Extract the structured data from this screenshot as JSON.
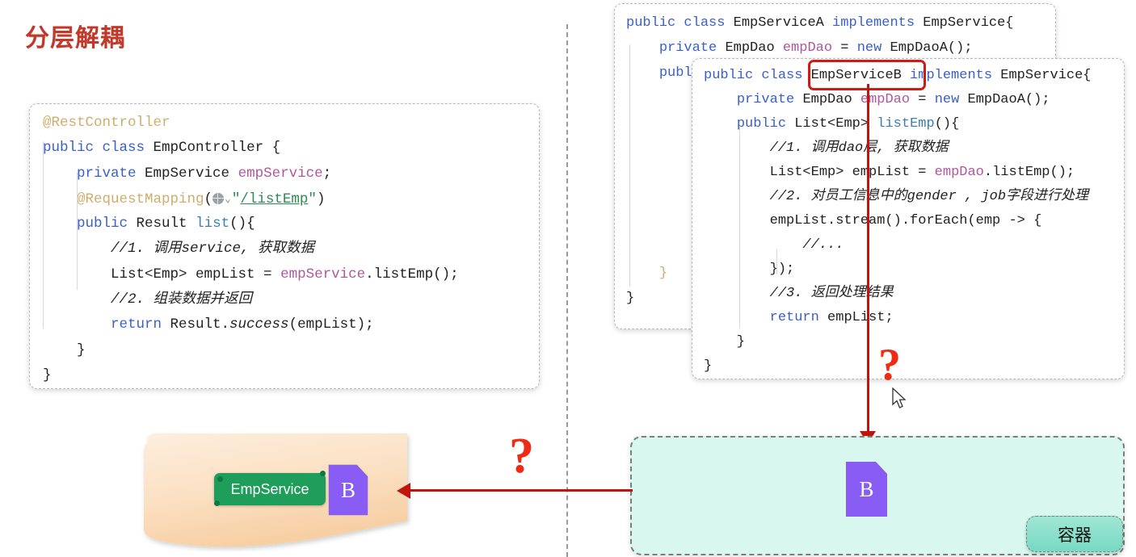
{
  "title": "分层解耦",
  "theme": {
    "title_color": "#c0392b",
    "accent_red": "#c0150f",
    "question_red": "#ef2b16",
    "bean_purple": "#8a5cf6",
    "tag_green": "#1e9e5a",
    "container_teal": "#d8f7ef",
    "badge_teal": "#77d9c2",
    "blob_orange": "#fbe0c3"
  },
  "left_code": {
    "name": "EmpController",
    "lines": [
      "@RestController",
      "public class EmpController {",
      "    private EmpService empService;",
      "    @RequestMapping(\"/listEmp\")",
      "    public Result list(){",
      "        //1. 调用service, 获取数据",
      "        List<Emp> empList = empService.listEmp();",
      "        //2. 组装数据并返回",
      "        return Result.success(empList);",
      "    }",
      "}"
    ],
    "mapping_path": "/listEmp",
    "icon": "globe-icon"
  },
  "service_a_code": {
    "name": "EmpServiceA",
    "lines": [
      "public class EmpServiceA implements EmpService{",
      "    private EmpDao empDao = new EmpDaoA();",
      "    public",
      "",
      "",
      "",
      "",
      "",
      "",
      "",
      "",
      "    }",
      "}"
    ]
  },
  "service_b_code": {
    "name": "EmpServiceB",
    "highlighted_token": "EmpServiceB",
    "lines": [
      "public class EmpServiceB implements EmpService{",
      "    private EmpDao empDao = new EmpDaoA();",
      "    public List<Emp> listEmp(){",
      "        //1. 调用dao层, 获取数据",
      "        List<Emp> empList = empDao.listEmp();",
      "        //2. 对员工信息中的gender , job字段进行处理",
      "        empList.stream().forEach(emp -> {",
      "            //...",
      "        });",
      "        //3. 返回处理结果",
      "        return empList;",
      "    }",
      "}"
    ]
  },
  "diagram": {
    "left_panel": {
      "tag_label": "EmpService",
      "bean_label": "B"
    },
    "right_panel": {
      "bean_label": "B",
      "badge_label": "容器"
    },
    "question_mark_left": "?",
    "question_mark_right": "?"
  }
}
